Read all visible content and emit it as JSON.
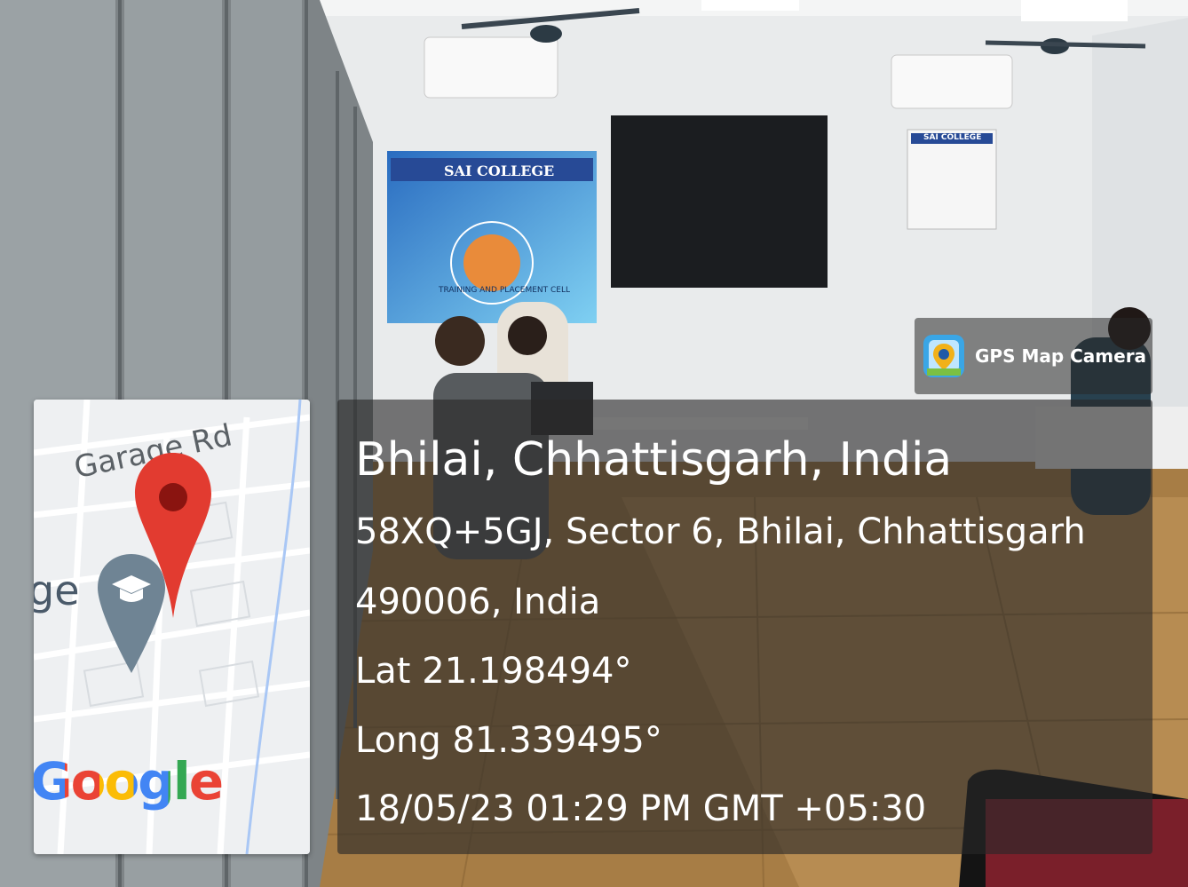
{
  "badge": {
    "label": "GPS Map Camera",
    "icon": "gps-camera-app-icon"
  },
  "location": {
    "city_line": "Bhilai, Chhattisgarh, India",
    "address_line1": "58XQ+5GJ, Sector 6, Bhilai, Chhattisgarh",
    "address_line2": "490006, India",
    "latitude": "Lat 21.198494°",
    "longitude": "Long 81.339495°",
    "timestamp": "18/05/23 01:29 PM GMT +05:30"
  },
  "map": {
    "road_label": "Garage Rd",
    "place_label_fragment": "ge",
    "brand": "Google",
    "pin_color": "#e23b30",
    "poi_icon": "graduation-cap-icon"
  },
  "scene_text": {
    "banner_title": "SAI COLLEGE",
    "banner_arc": "TRAINING AND PLACEMENT CELL",
    "poster_title": "SAI COLLEGE"
  }
}
